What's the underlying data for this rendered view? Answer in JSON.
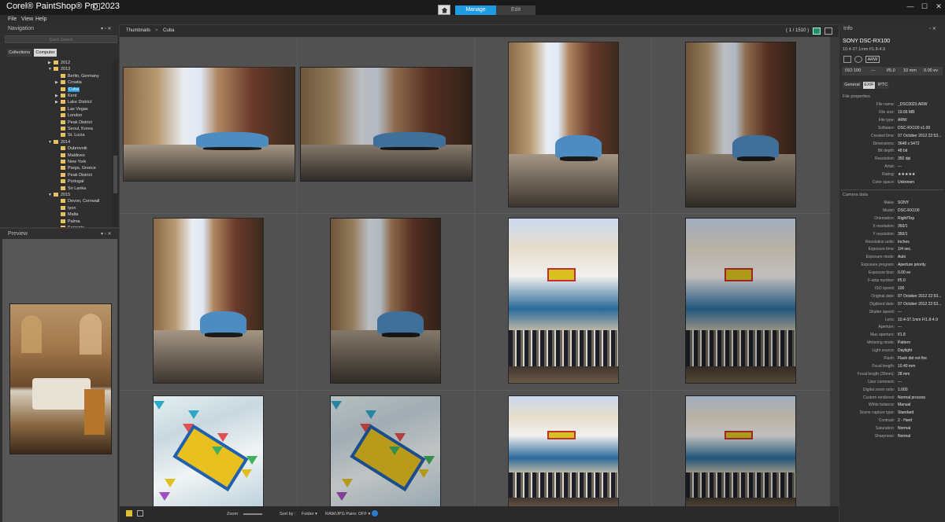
{
  "app": {
    "title": "Corel® PaintShop® Pro 2023"
  },
  "tabs": {
    "manage": "Manage",
    "edit": "Edit"
  },
  "menu": {
    "file": "File",
    "view": "View",
    "help": "Help"
  },
  "window_controls": {
    "minimize": "—",
    "maximize": "☐",
    "close": "✕"
  },
  "navigation": {
    "title": "Navigation",
    "search_placeholder": "Quick Search",
    "tab_collections": "Collections",
    "tab_computer": "Computer",
    "tree": [
      {
        "label": "2012",
        "level": 0,
        "arrow": "▶"
      },
      {
        "label": "2013",
        "level": 0,
        "arrow": "▼"
      },
      {
        "label": "Berlin, Germany",
        "level": 1,
        "arrow": ""
      },
      {
        "label": "Croatia",
        "level": 1,
        "arrow": "▶"
      },
      {
        "label": "Cuba",
        "level": 1,
        "arrow": "",
        "selected": true
      },
      {
        "label": "Kent",
        "level": 1,
        "arrow": "▶"
      },
      {
        "label": "Lake District",
        "level": 1,
        "arrow": "▶"
      },
      {
        "label": "Las Vegas",
        "level": 1,
        "arrow": ""
      },
      {
        "label": "London",
        "level": 1,
        "arrow": ""
      },
      {
        "label": "Peak District",
        "level": 1,
        "arrow": ""
      },
      {
        "label": "Seoul, Korea",
        "level": 1,
        "arrow": ""
      },
      {
        "label": "St. Lucia",
        "level": 1,
        "arrow": ""
      },
      {
        "label": "2014",
        "level": 0,
        "arrow": "▼"
      },
      {
        "label": "Dubrovnik",
        "level": 1,
        "arrow": ""
      },
      {
        "label": "Maldives",
        "level": 1,
        "arrow": ""
      },
      {
        "label": "New York",
        "level": 1,
        "arrow": ""
      },
      {
        "label": "Parga, Greece",
        "level": 1,
        "arrow": ""
      },
      {
        "label": "Peak District",
        "level": 1,
        "arrow": ""
      },
      {
        "label": "Portugal",
        "level": 1,
        "arrow": ""
      },
      {
        "label": "Sri Lanka",
        "level": 1,
        "arrow": ""
      },
      {
        "label": "2015",
        "level": 0,
        "arrow": "▼"
      },
      {
        "label": "Devon, Cornwall",
        "level": 1,
        "arrow": ""
      },
      {
        "label": "Iyon",
        "level": 1,
        "arrow": ""
      },
      {
        "label": "Malta",
        "level": 1,
        "arrow": ""
      },
      {
        "label": "Palma",
        "level": 1,
        "arrow": ""
      },
      {
        "label": "Sorrento",
        "level": 1,
        "arrow": ""
      }
    ]
  },
  "preview": {
    "title": "Preview"
  },
  "breadcrumb": {
    "root": "Thumbnails",
    "separator": ">",
    "current": "Cuba"
  },
  "counter": "( 1 / 1510 )",
  "thumbnails": [
    {
      "kind": "street",
      "dark": false
    },
    {
      "kind": "street",
      "dark": true
    },
    {
      "kind": "street",
      "dark": false
    },
    {
      "kind": "street",
      "dark": true
    },
    {
      "kind": "street",
      "dark": false
    },
    {
      "kind": "street",
      "dark": true
    },
    {
      "kind": "market",
      "dark": false
    },
    {
      "kind": "market",
      "dark": true
    },
    {
      "kind": "flags",
      "dark": false
    },
    {
      "kind": "flags",
      "dark": true
    },
    {
      "kind": "market",
      "dark": false
    },
    {
      "kind": "market",
      "dark": true
    }
  ],
  "bottom_bar": {
    "zoom_label": "Zoom",
    "sort_label": "Sort by :",
    "sort_value": "Folder ▾",
    "raw_pairs": "RAW/JPG Pairs: OFF ▾"
  },
  "info": {
    "title": "Info",
    "camera": "SONY DSC-RX100",
    "lens": "10.4-37.1mm f/1.8-4.9",
    "format_badge": "ARW",
    "strip": {
      "iso": "ISO 100",
      "shutter": "---",
      "aperture": "f/5.0",
      "focal": "10 mm",
      "ev": "0.00 ev"
    },
    "tabs": {
      "general": "General",
      "exif": "EXIF",
      "iptc": "IPTC"
    },
    "file_section": "File properties",
    "file_props": [
      {
        "k": "File name:",
        "v": "_DSC0023.ARW"
      },
      {
        "k": "File size:",
        "v": "19.66 MB"
      },
      {
        "k": "File type:",
        "v": "ARW"
      },
      {
        "k": "Software:",
        "v": "DSC-RX100 v1.00"
      },
      {
        "k": "Created time:",
        "v": "07 October 2012 22:53..."
      },
      {
        "k": "Dimensions:",
        "v": "3648 x 5472"
      },
      {
        "k": "Bit depth:",
        "v": "48 bit"
      },
      {
        "k": "Resolution:",
        "v": "350 dpi"
      },
      {
        "k": "Artist:",
        "v": "---"
      },
      {
        "k": "Rating:",
        "v": "★★★★★"
      },
      {
        "k": "Color space:",
        "v": "Unknown"
      }
    ],
    "camera_section": "Camera data",
    "camera_props": [
      {
        "k": "Make:",
        "v": "SONY"
      },
      {
        "k": "Model:",
        "v": "DSC-RX100"
      },
      {
        "k": "Orientation:",
        "v": "Right/Top"
      },
      {
        "k": "X resolution:",
        "v": "350/1"
      },
      {
        "k": "Y resolution:",
        "v": "350/1"
      },
      {
        "k": "Resolution units:",
        "v": "Inches"
      },
      {
        "k": "Exposure time:",
        "v": "1/4 sec."
      },
      {
        "k": "Exposure mode:",
        "v": "Auto"
      },
      {
        "k": "Exposure program:",
        "v": "Aperture priority"
      },
      {
        "k": "Exposure bias:",
        "v": "0.00 ev"
      },
      {
        "k": "F-stop number:",
        "v": "f/5.0"
      },
      {
        "k": "ISO speed:",
        "v": "100"
      },
      {
        "k": "Original date:",
        "v": "07 October 2012 22:53..."
      },
      {
        "k": "Digitized date:",
        "v": "07 October 2012 22:53..."
      },
      {
        "k": "Shutter speed:",
        "v": "---"
      },
      {
        "k": "Lens:",
        "v": "10.4-37.1mm F/1.8-4.9"
      },
      {
        "k": "Aperture:",
        "v": "---"
      },
      {
        "k": "Max aperture:",
        "v": "f/1.8"
      },
      {
        "k": "Metering mode:",
        "v": "Pattern"
      },
      {
        "k": "Light source:",
        "v": "Daylight"
      },
      {
        "k": "Flash:",
        "v": "Flash did not fire"
      },
      {
        "k": "Focal length:",
        "v": "10.40 mm"
      },
      {
        "k": "Focal length (35mm):",
        "v": "28 mm"
      },
      {
        "k": "User comment:",
        "v": "---"
      },
      {
        "k": "Digital zoom ratio:",
        "v": "1.000"
      },
      {
        "k": "Custom rendered:",
        "v": "Normal process"
      },
      {
        "k": "White balance:",
        "v": "Manual"
      },
      {
        "k": "Scene capture type:",
        "v": "Standard"
      },
      {
        "k": "Contrast:",
        "v": "2 - Hard"
      },
      {
        "k": "Saturation:",
        "v": "Normal"
      },
      {
        "k": "Sharpness:",
        "v": "Normal"
      }
    ]
  },
  "colors": {
    "accent": "#1e9be1",
    "panel": "#2f2f2f",
    "grid": "#515151"
  }
}
